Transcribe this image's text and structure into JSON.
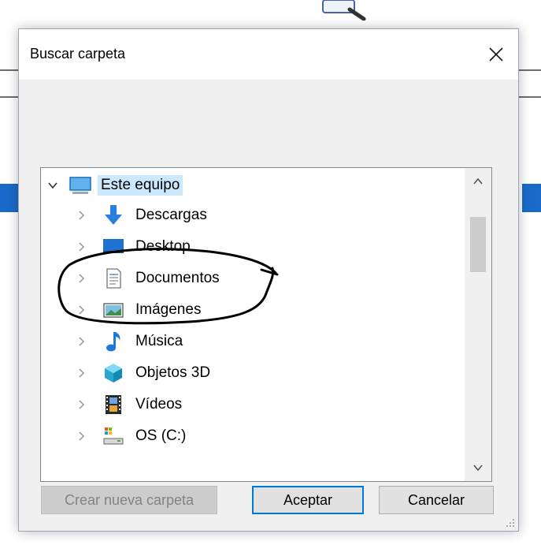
{
  "dialog": {
    "title": "Buscar carpeta",
    "close_label": "×"
  },
  "tree": {
    "root": {
      "label": "Este equipo",
      "icon": "computer-icon",
      "expanded": true,
      "selected": true
    },
    "items": [
      {
        "label": "Descargas",
        "icon": "download-arrow-icon"
      },
      {
        "label": "Desktop",
        "icon": "desktop-folder-icon"
      },
      {
        "label": "Documentos",
        "icon": "document-icon"
      },
      {
        "label": "Imágenes",
        "icon": "picture-icon"
      },
      {
        "label": "Música",
        "icon": "music-note-icon"
      },
      {
        "label": "Objetos 3D",
        "icon": "cube-3d-icon"
      },
      {
        "label": "Vídeos",
        "icon": "film-icon"
      },
      {
        "label": "OS (C:)",
        "icon": "drive-icon"
      }
    ]
  },
  "buttons": {
    "new_folder": "Crear nueva carpeta",
    "accept": "Aceptar",
    "cancel": "Cancelar"
  },
  "colors": {
    "selection": "#cce8ff",
    "accent": "#0078d7",
    "annotation": "#000000"
  }
}
